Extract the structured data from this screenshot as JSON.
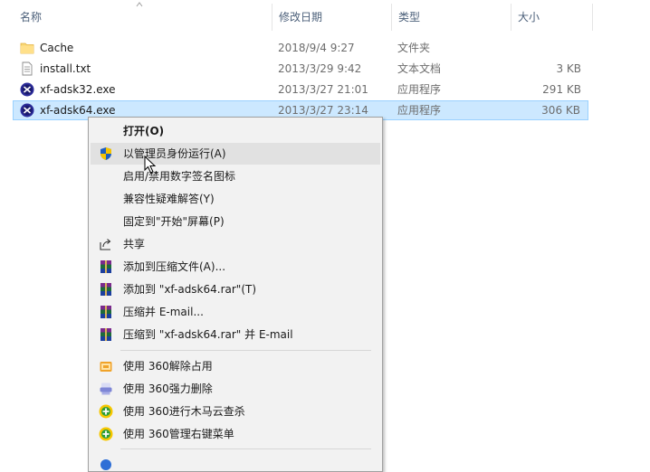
{
  "columns": {
    "name": "名称",
    "date": "修改日期",
    "type": "类型",
    "size": "大小"
  },
  "files": [
    {
      "name": "Cache",
      "date": "2018/9/4 9:27",
      "type": "文件夹",
      "size": "",
      "icon": "folder-icon"
    },
    {
      "name": "install.txt",
      "date": "2013/3/29 9:42",
      "type": "文本文档",
      "size": "3 KB",
      "icon": "text-file-icon"
    },
    {
      "name": "xf-adsk32.exe",
      "date": "2013/3/27 21:01",
      "type": "应用程序",
      "size": "291 KB",
      "icon": "xforce-app-icon"
    },
    {
      "name": "xf-adsk64.exe",
      "date": "2013/3/27 23:14",
      "type": "应用程序",
      "size": "306 KB",
      "icon": "xforce-app-icon",
      "selected": true
    }
  ],
  "context_menu": {
    "open": "打开(O)",
    "run_as_admin": "以管理员身份运行(A)",
    "toggle_signature": "启用/禁用数字签名图标",
    "compat_troubleshoot": "兼容性疑难解答(Y)",
    "pin_start": "固定到\"开始\"屏幕(P)",
    "share": "共享",
    "add_to_archive": "添加到压缩文件(A)...",
    "add_to_rar": "添加到 \"xf-adsk64.rar\"(T)",
    "compress_email": "压缩并 E-mail...",
    "compress_rar_email": "压缩到 \"xf-adsk64.rar\" 并 E-mail",
    "unlock_360": "使用 360解除占用",
    "force_delete_360": "使用 360强力删除",
    "trojan_scan_360": "使用 360进行木马云查杀",
    "manage_menu_360": "使用 360管理右键菜单"
  },
  "colors": {
    "selection_bg": "#cce8ff",
    "selection_border": "#99d1ff",
    "menu_bg": "#f2f2f2",
    "menu_highlight": "#e1e1e1",
    "header_text": "#4c607a"
  }
}
